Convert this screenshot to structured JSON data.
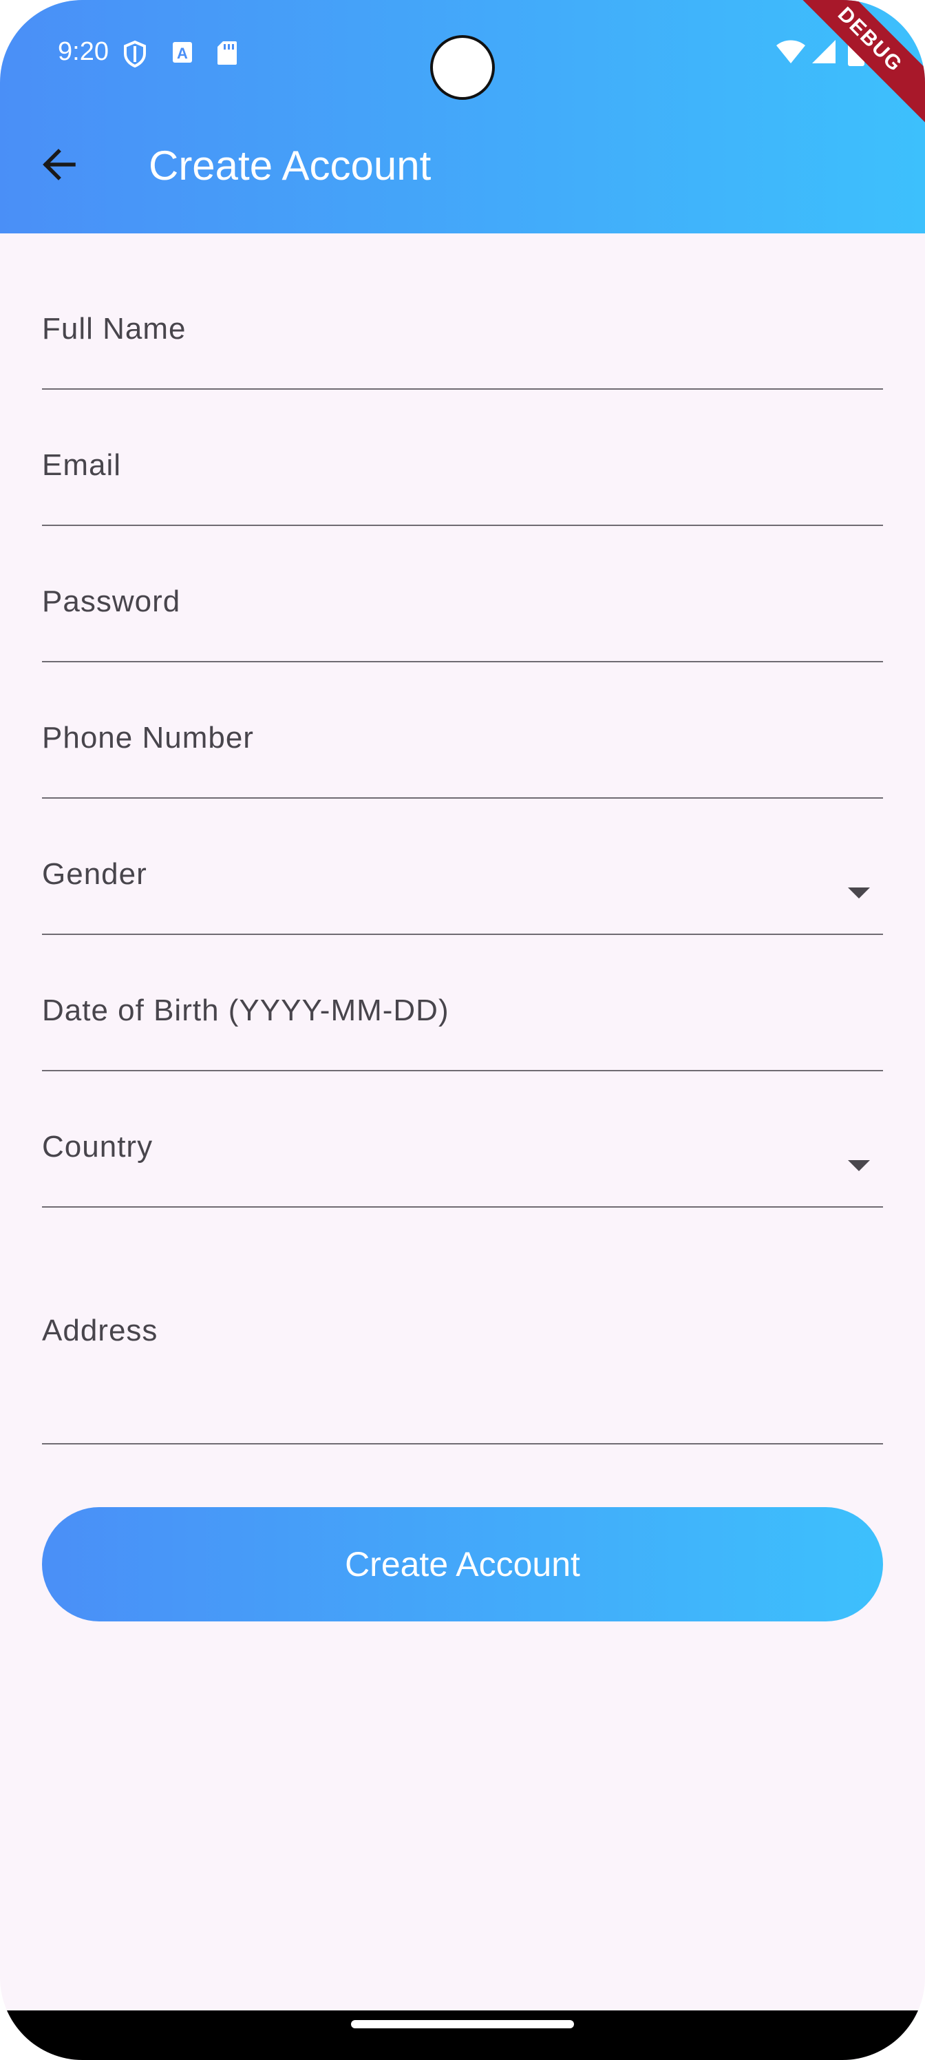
{
  "status_bar": {
    "time": "9:20",
    "icons_left": [
      "shield-icon",
      "a-box-icon",
      "sd-card-icon"
    ],
    "icons_right": [
      "wifi-icon",
      "signal-icon",
      "battery-icon"
    ]
  },
  "app_bar": {
    "title": "Create Account",
    "back_icon": "arrow-left-icon",
    "debug_badge": "DEBUG",
    "gradient": [
      "#4a8ff7",
      "#3dc0fc"
    ]
  },
  "form": {
    "fields": [
      {
        "key": "full_name",
        "label": "Full Name",
        "value": "",
        "type": "text"
      },
      {
        "key": "email",
        "label": "Email",
        "value": "",
        "type": "text"
      },
      {
        "key": "password",
        "label": "Password",
        "value": "",
        "type": "password"
      },
      {
        "key": "phone",
        "label": "Phone Number",
        "value": "",
        "type": "text"
      },
      {
        "key": "gender",
        "label": "Gender",
        "value": "",
        "type": "dropdown"
      },
      {
        "key": "dob",
        "label": "Date of Birth (YYYY-MM-DD)",
        "value": "",
        "type": "text"
      },
      {
        "key": "country",
        "label": "Country",
        "value": "",
        "type": "dropdown"
      },
      {
        "key": "address",
        "label": "Address",
        "value": "",
        "type": "multiline"
      }
    ],
    "submit_label": "Create Account"
  },
  "colors": {
    "background": "#fbf4fb",
    "label": "#48454c",
    "underline": "#6f6b72",
    "accent_start": "#4a8ff7",
    "accent_end": "#3dc0fc"
  }
}
